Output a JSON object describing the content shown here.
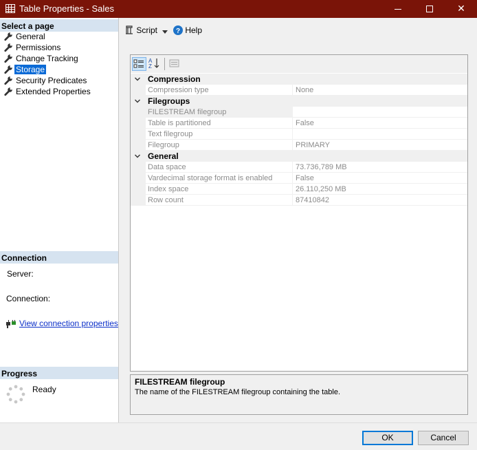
{
  "window": {
    "title": "Table Properties - Sales"
  },
  "left_panel": {
    "select_page_header": "Select a page",
    "pages": [
      {
        "label": "General",
        "selected": false
      },
      {
        "label": "Permissions",
        "selected": false
      },
      {
        "label": "Change Tracking",
        "selected": false
      },
      {
        "label": "Storage",
        "selected": true
      },
      {
        "label": "Security Predicates",
        "selected": false
      },
      {
        "label": "Extended Properties",
        "selected": false
      }
    ],
    "connection_header": "Connection",
    "server_label": "Server:",
    "connection_label": "Connection:",
    "view_connection_link": "View connection properties",
    "progress_header": "Progress",
    "progress_status": "Ready"
  },
  "toolbar": {
    "script_label": "Script",
    "help_label": "Help"
  },
  "grid": {
    "categories": [
      {
        "name": "Compression",
        "rows": [
          {
            "name": "Compression type",
            "value": "None"
          }
        ]
      },
      {
        "name": "Filegroups",
        "rows": [
          {
            "name": "FILESTREAM filegroup",
            "value": ""
          },
          {
            "name": "Table is partitioned",
            "value": "False"
          },
          {
            "name": "Text filegroup",
            "value": ""
          },
          {
            "name": "Filegroup",
            "value": "PRIMARY"
          }
        ]
      },
      {
        "name": "General",
        "rows": [
          {
            "name": "Data space",
            "value": "73.736,789 MB"
          },
          {
            "name": "Vardecimal storage format is enabled",
            "value": "False"
          },
          {
            "name": "Index space",
            "value": "26.110,250 MB"
          },
          {
            "name": "Row count",
            "value": "87410842"
          }
        ]
      }
    ]
  },
  "description": {
    "title": "FILESTREAM filegroup",
    "text": "The name of the FILESTREAM filegroup containing the table."
  },
  "buttons": {
    "ok": "OK",
    "cancel": "Cancel"
  },
  "colors": {
    "titlebar": "#7a1408",
    "selection": "#0a6ad6",
    "section_header": "#d6e3f0",
    "link": "#0b2fc8"
  },
  "icons": {
    "help": "help-icon",
    "script": "script-icon",
    "page": "wrench-icon"
  }
}
